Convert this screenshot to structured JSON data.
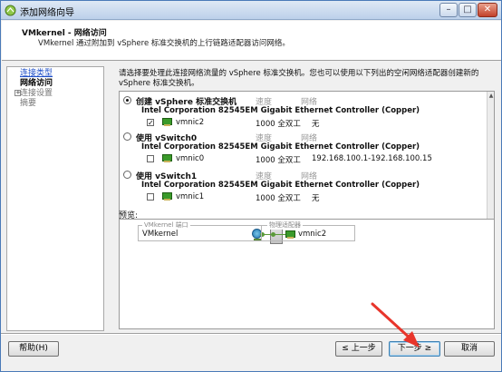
{
  "window": {
    "title": "添加网络向导"
  },
  "header": {
    "title": "VMkernel - 网络访问",
    "description": "VMkernel 通过附加到 vSphere 标准交换机的上行链路适配器访问网络。"
  },
  "nav": {
    "items": [
      {
        "label": "连接类型",
        "state": "link"
      },
      {
        "label": "网络访问",
        "state": "current"
      },
      {
        "label": "连接设置",
        "state": "muted"
      },
      {
        "label": "摘要",
        "state": "muted"
      }
    ]
  },
  "instructions": "请选择要处理此连接网络流量的 vSphere 标准交换机。您也可以使用以下列出的空闲网络适配器创建新的 vSphere 标准交换机。",
  "columns": {
    "speed": "速度",
    "network": "网络"
  },
  "switch_options": [
    {
      "title": "创建 vSphere 标准交换机",
      "selected": true,
      "nic_description": "Intel Corporation 82545EM Gigabit Ethernet Controller (Copper)",
      "nic": {
        "name": "vmnic2",
        "checked": true,
        "speed": "1000 全双工",
        "network": "无"
      }
    },
    {
      "title": "使用 vSwitch0",
      "selected": false,
      "nic_description": "Intel Corporation 82545EM Gigabit Ethernet Controller (Copper)",
      "nic": {
        "name": "vmnic0",
        "checked": false,
        "speed": "1000 全双工",
        "network": "192.168.100.1-192.168.100.15"
      }
    },
    {
      "title": "使用 vSwitch1",
      "selected": false,
      "nic_description": "Intel Corporation 82545EM Gigabit Ethernet Controller (Copper)",
      "nic": {
        "name": "vmnic1",
        "checked": false,
        "speed": "1000 全双工",
        "network": "无"
      }
    }
  ],
  "preview": {
    "label": "预览:",
    "port_group_caption": "VMkernel 端口",
    "adapter_caption": "物理适配器",
    "port_name": "VMkernel",
    "adapter_name": "vmnic2"
  },
  "buttons": {
    "help": "帮助(H)",
    "back": "≤ 上一步",
    "next": "下一步 ≥",
    "cancel": "取消"
  },
  "colors": {
    "accent": "#2050c8",
    "annotation_arrow": "#e8352b",
    "nic_green": "#3a9a2a"
  }
}
